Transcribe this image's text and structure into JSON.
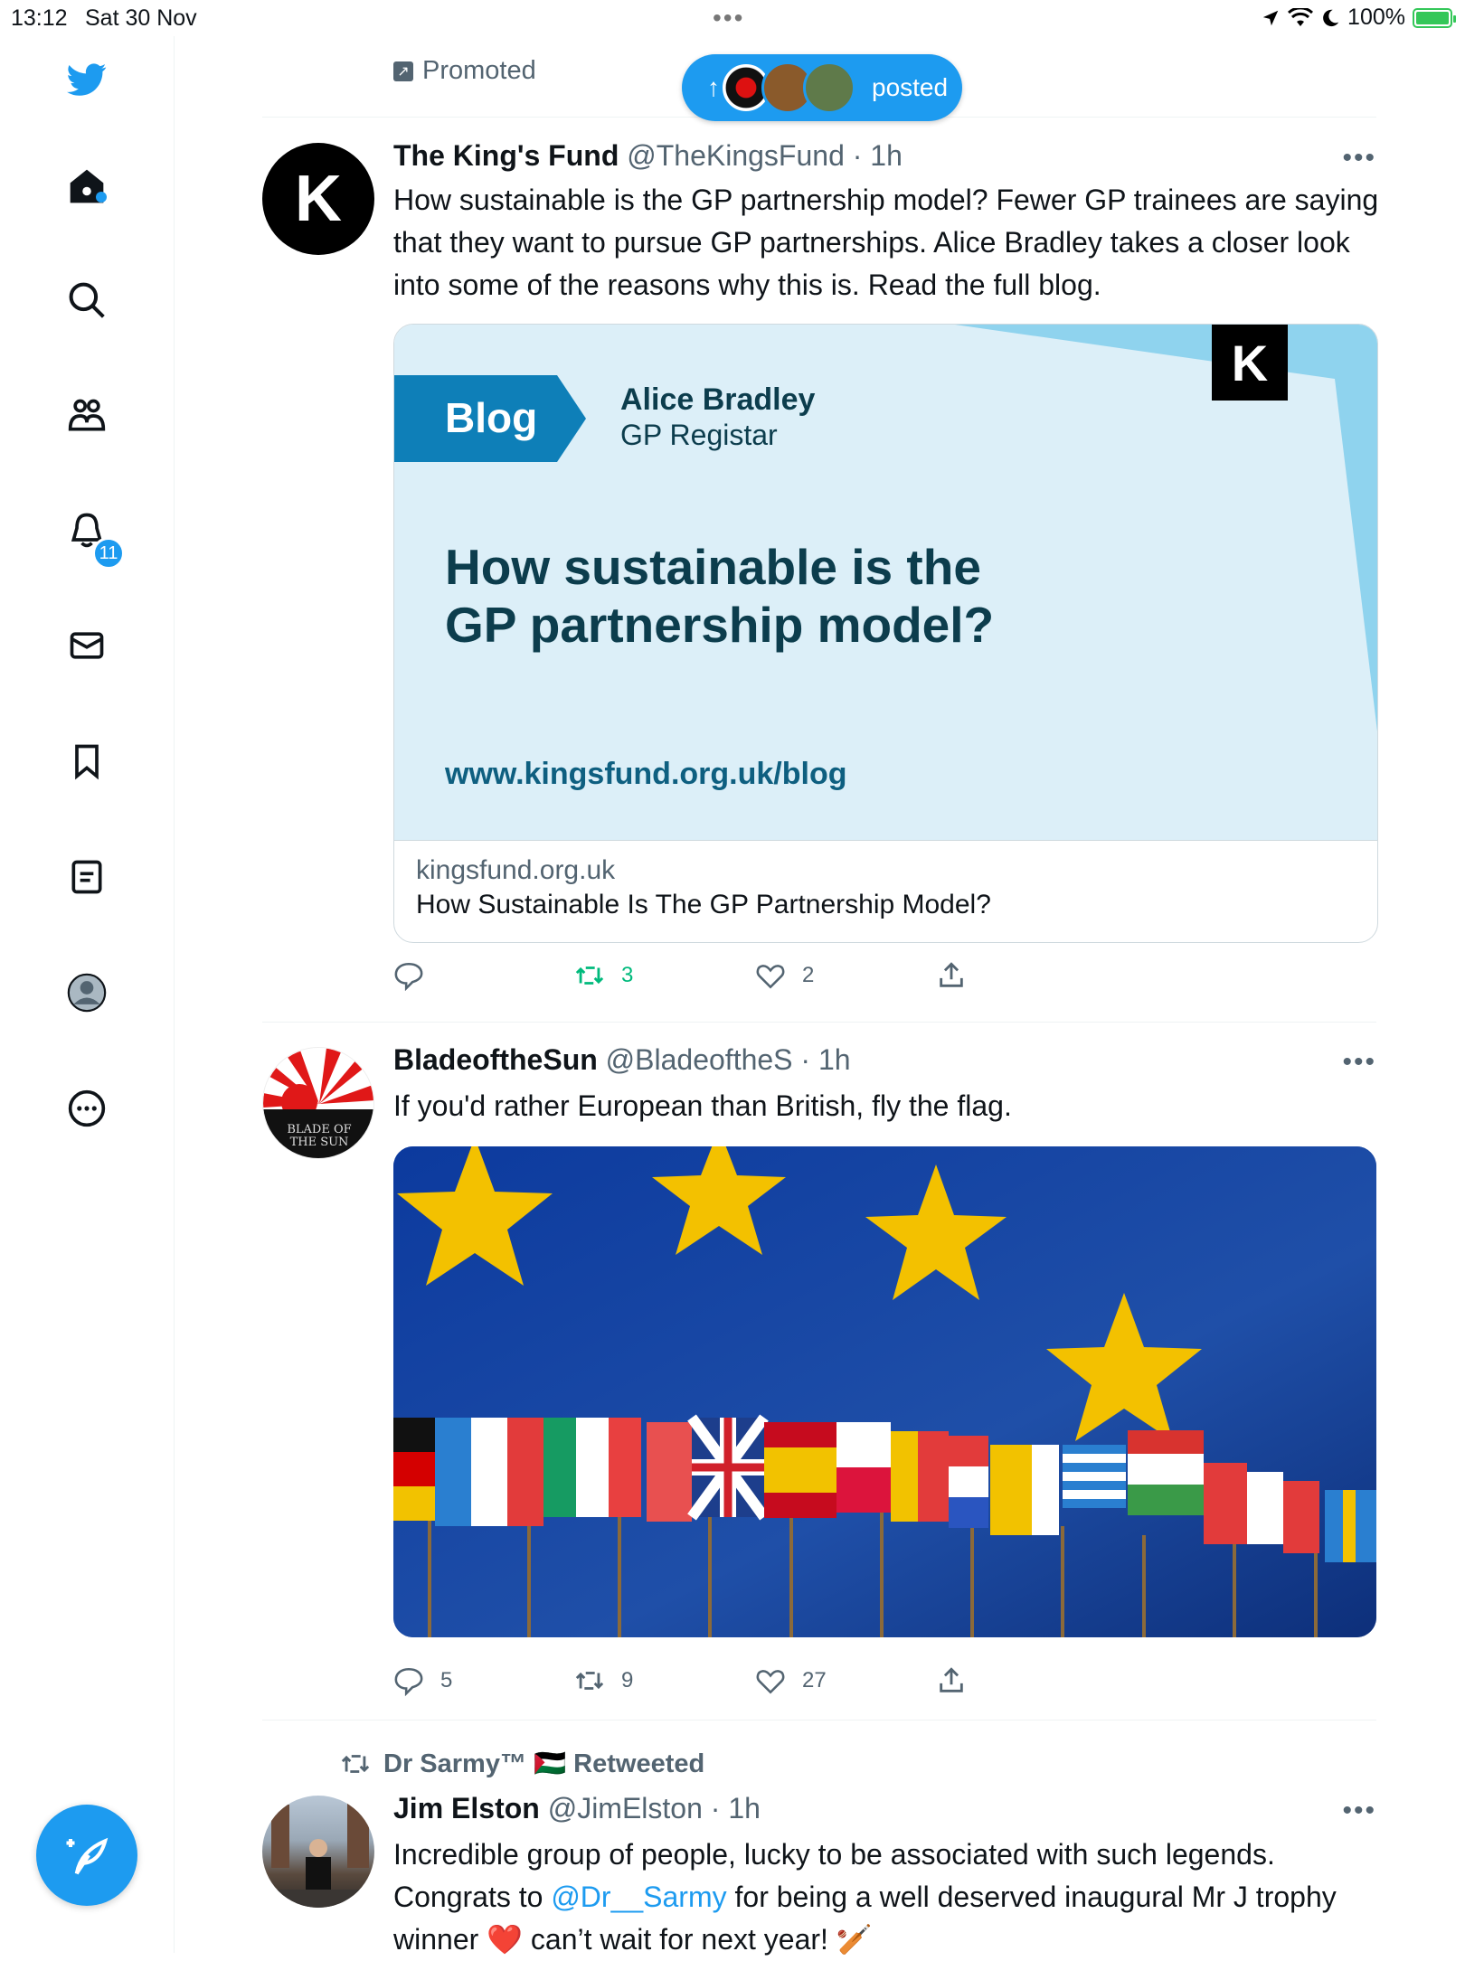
{
  "status_bar": {
    "time": "13:12",
    "date": "Sat 30 Nov",
    "battery": "100%"
  },
  "sidebar": {
    "notifications_badge": "11"
  },
  "feed": {
    "promoted_label": "Promoted",
    "new_posts_pill": "posted"
  },
  "tweets": [
    {
      "name": "The King's Fund",
      "handle": "@TheKingsFund",
      "time": "1h",
      "avatar_letter": "K",
      "text": "How sustainable is the GP partnership model? Fewer GP trainees are saying that they want to pursue GP partnerships. Alice Bradley takes a closer look into some of the reasons why this is. Read the full blog.",
      "card": {
        "tag": "Blog",
        "author": "Alice Bradley",
        "role": "GP Registar",
        "logo": "K",
        "headline_line1": "How sustainable is the",
        "headline_line2": "GP partnership model?",
        "url_text": "www.kingsfund.org.uk/blog",
        "domain": "kingsfund.org.uk",
        "title": "How Sustainable Is The GP Partnership Model?"
      },
      "replies": "",
      "retweets": "3",
      "likes": "2"
    },
    {
      "name": "BladeoftheSun",
      "handle": "@BladeoftheS",
      "time": "1h",
      "avatar_text": "BLADE OF THE SUN",
      "text": "If you'd rather European than British, fly the flag.",
      "replies": "5",
      "retweets": "9",
      "likes": "27"
    },
    {
      "retweeted_by": "Dr Sarmy™ 🇵🇸 Retweeted",
      "name": "Jim Elston",
      "handle": "@JimElston",
      "time": "1h",
      "text_part1": "Incredible group of people, lucky to be associated with such legends. Congrats to ",
      "mention": "@Dr__Sarmy",
      "text_part2": " for being a well deserved inaugural Mr J trophy winner ❤️ can’t wait for next year! 🏏"
    }
  ],
  "colors": {
    "accent": "#1d9bf0",
    "retweet_green": "#00ba7c",
    "secondary_text": "#536471",
    "card_teal": "#0e7fb8",
    "card_text": "#0c3d4d"
  }
}
